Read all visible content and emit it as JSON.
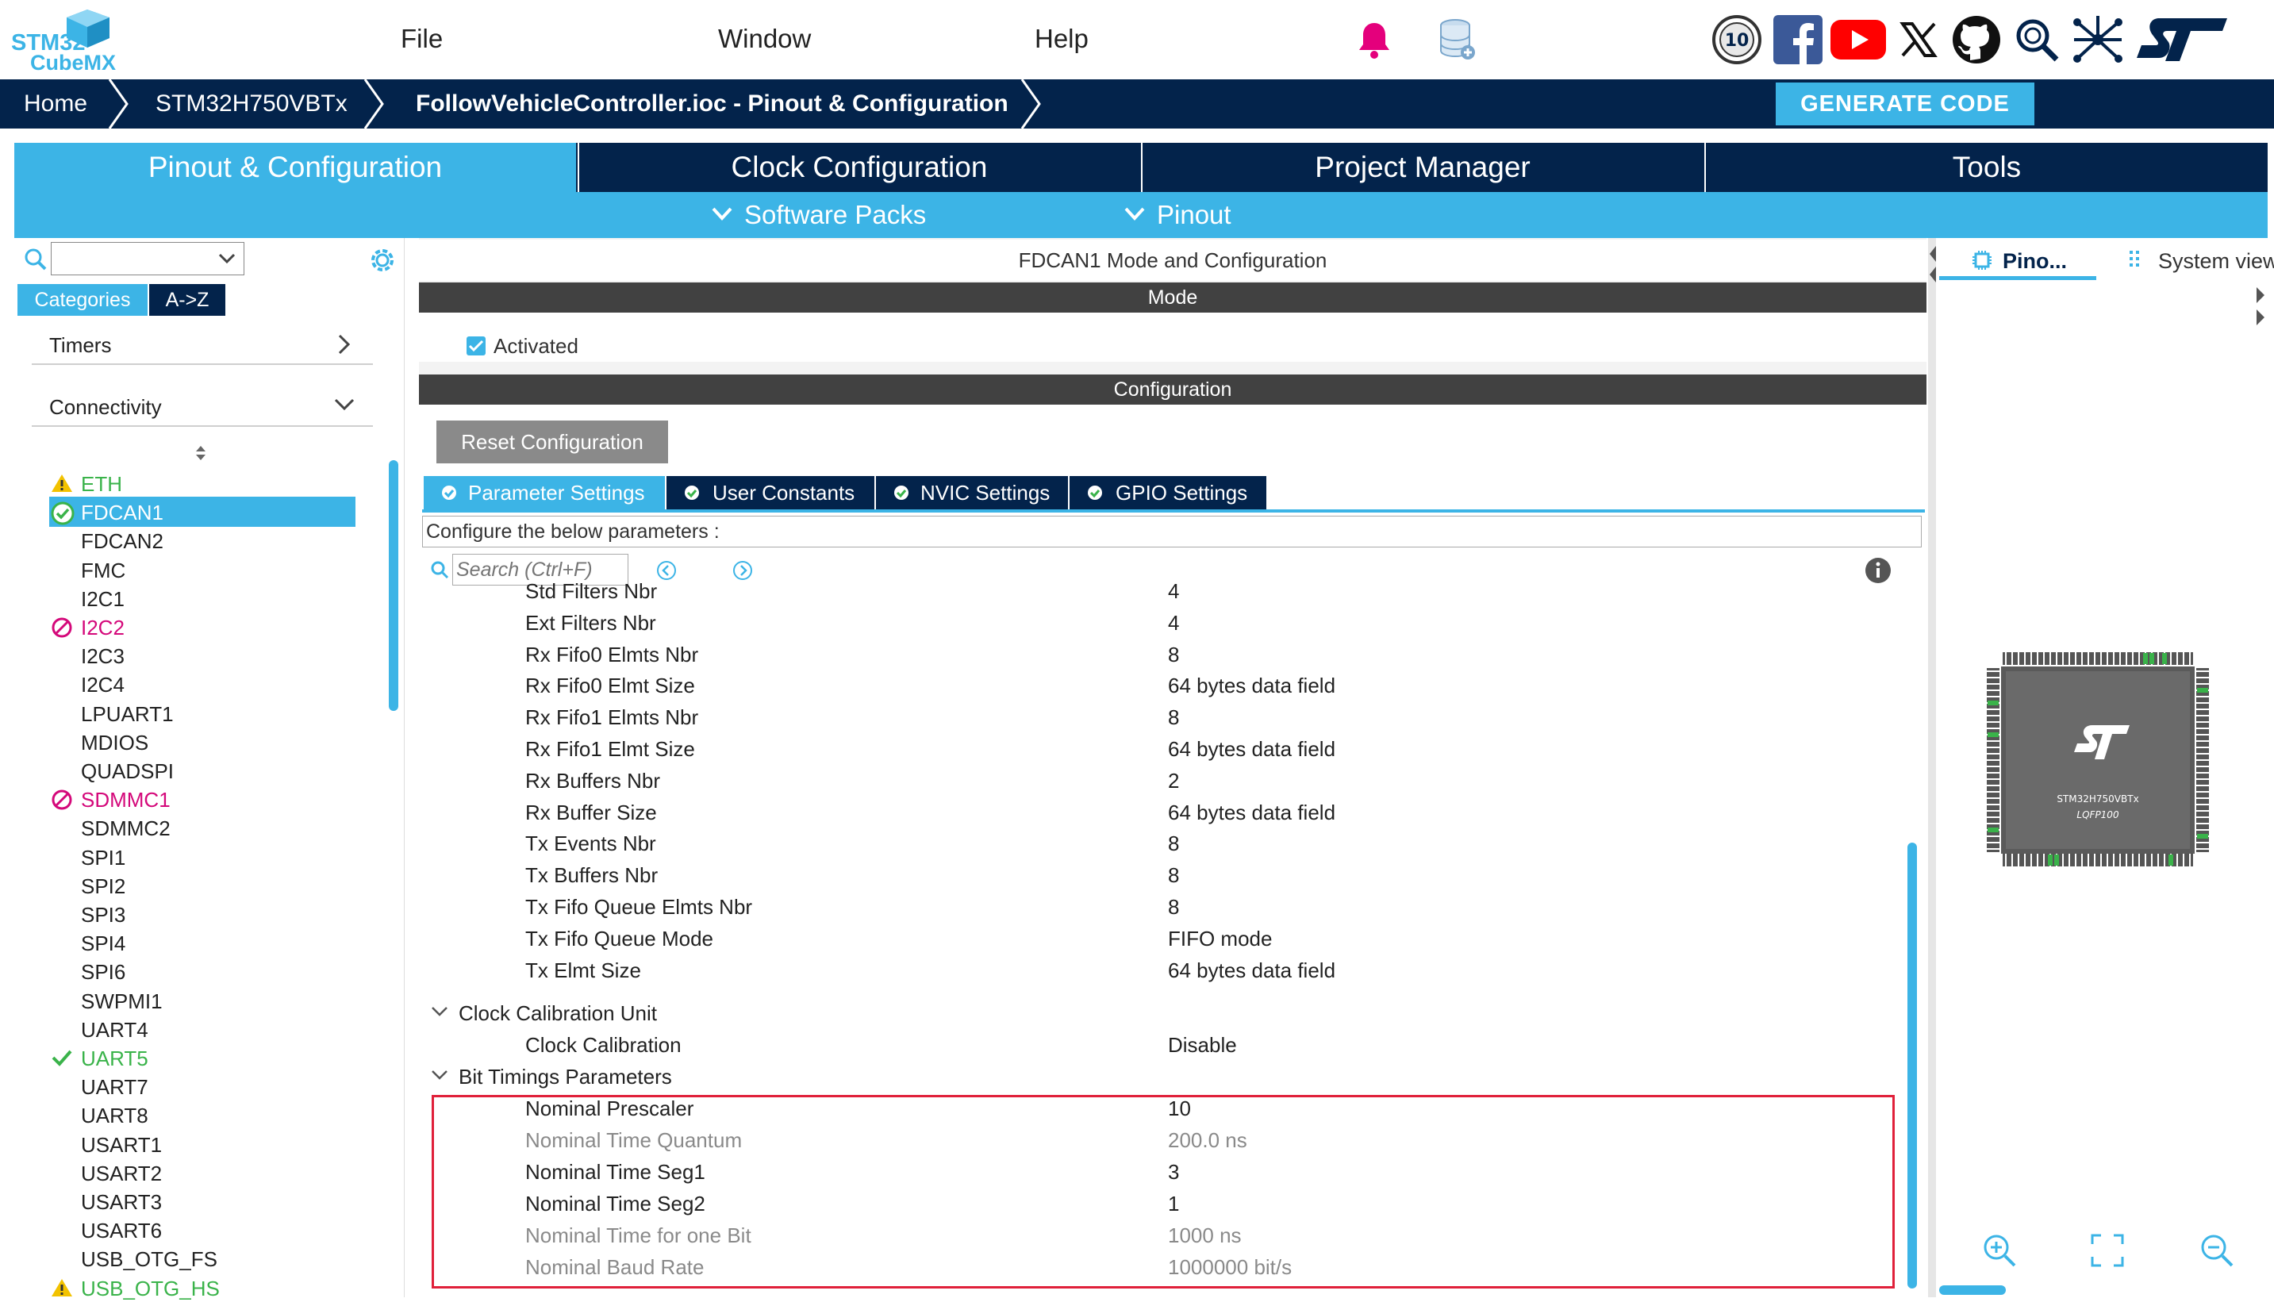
{
  "app": {
    "logo_line1": "STM32",
    "logo_line2": "CubeMX",
    "menu": [
      "File",
      "Window",
      "Help"
    ]
  },
  "breadcrumb": {
    "home": "Home",
    "device": "STM32H750VBTx",
    "project": "FollowVehicleController.ioc - Pinout & Configuration"
  },
  "generate_label": "GENERATE CODE",
  "main_tabs": [
    "Pinout & Configuration",
    "Clock Configuration",
    "Project Manager",
    "Tools"
  ],
  "sub_menus": [
    "Software Packs",
    "Pinout"
  ],
  "left": {
    "view_tabs": [
      "Categories",
      "A->Z"
    ],
    "categories": [
      "Timers",
      "Connectivity"
    ],
    "items": [
      {
        "label": "ETH",
        "state": "warning"
      },
      {
        "label": "FDCAN1",
        "state": "selected"
      },
      {
        "label": "FDCAN2",
        "state": ""
      },
      {
        "label": "FMC",
        "state": ""
      },
      {
        "label": "I2C1",
        "state": ""
      },
      {
        "label": "I2C2",
        "state": "disabled"
      },
      {
        "label": "I2C3",
        "state": ""
      },
      {
        "label": "I2C4",
        "state": ""
      },
      {
        "label": "LPUART1",
        "state": ""
      },
      {
        "label": "MDIOS",
        "state": ""
      },
      {
        "label": "QUADSPI",
        "state": ""
      },
      {
        "label": "SDMMC1",
        "state": "disabled"
      },
      {
        "label": "SDMMC2",
        "state": ""
      },
      {
        "label": "SPI1",
        "state": ""
      },
      {
        "label": "SPI2",
        "state": ""
      },
      {
        "label": "SPI3",
        "state": ""
      },
      {
        "label": "SPI4",
        "state": ""
      },
      {
        "label": "SPI6",
        "state": ""
      },
      {
        "label": "SWPMI1",
        "state": ""
      },
      {
        "label": "UART4",
        "state": ""
      },
      {
        "label": "UART5",
        "state": "ok"
      },
      {
        "label": "UART7",
        "state": ""
      },
      {
        "label": "UART8",
        "state": ""
      },
      {
        "label": "USART1",
        "state": ""
      },
      {
        "label": "USART2",
        "state": ""
      },
      {
        "label": "USART3",
        "state": ""
      },
      {
        "label": "USART6",
        "state": ""
      },
      {
        "label": "USB_OTG_FS",
        "state": ""
      },
      {
        "label": "USB_OTG_HS",
        "state": "warning"
      }
    ]
  },
  "center": {
    "title": "FDCAN1 Mode and Configuration",
    "mode_header": "Mode",
    "activated_label": "Activated",
    "config_header": "Configuration",
    "reset_label": "Reset Configuration",
    "param_tabs": [
      "Parameter Settings",
      "User Constants",
      "NVIC Settings",
      "GPIO Settings"
    ],
    "configure_text": "Configure the below parameters :",
    "search_placeholder": "Search (Ctrl+F)",
    "params": [
      {
        "name": "Std Filters Nbr",
        "value": "4"
      },
      {
        "name": "Ext Filters Nbr",
        "value": "4"
      },
      {
        "name": "Rx Fifo0 Elmts Nbr",
        "value": "8"
      },
      {
        "name": "Rx Fifo0 Elmt Size",
        "value": "64 bytes data field"
      },
      {
        "name": "Rx Fifo1 Elmts Nbr",
        "value": "8"
      },
      {
        "name": "Rx Fifo1 Elmt Size",
        "value": "64 bytes data field"
      },
      {
        "name": "Rx Buffers Nbr",
        "value": "2"
      },
      {
        "name": "Rx Buffer Size",
        "value": "64 bytes data field"
      },
      {
        "name": "Tx Events Nbr",
        "value": "8"
      },
      {
        "name": "Tx Buffers Nbr",
        "value": "8"
      },
      {
        "name": "Tx Fifo Queue Elmts Nbr",
        "value": "8"
      },
      {
        "name": "Tx Fifo Queue Mode",
        "value": "FIFO mode"
      },
      {
        "name": "Tx Elmt Size",
        "value": "64 bytes data field"
      }
    ],
    "group_clock": "Clock Calibration Unit",
    "clock_param": {
      "name": "Clock Calibration",
      "value": "Disable"
    },
    "group_bit": "Bit Timings Parameters",
    "bit_params": [
      {
        "name": "Nominal Prescaler",
        "value": "10",
        "dim": false
      },
      {
        "name": "Nominal Time Quantum",
        "value": "200.0 ns",
        "dim": true
      },
      {
        "name": "Nominal Time Seg1",
        "value": "3",
        "dim": false
      },
      {
        "name": "Nominal Time Seg2",
        "value": "1",
        "dim": false
      },
      {
        "name": "Nominal Time for one Bit",
        "value": "1000 ns",
        "dim": true
      },
      {
        "name": "Nominal Baud Rate",
        "value": "1000000 bit/s",
        "dim": true
      }
    ]
  },
  "right": {
    "tab_pinout": "Pino...",
    "tab_system": "System view",
    "chip_name": "STM32H750VBTx",
    "chip_package": "LQFP100"
  },
  "colors": {
    "navy": "#03234b",
    "accent": "#3cb4e6",
    "selected": "#3cb4e6",
    "ok": "#3ab34a",
    "warning": "#f2c200",
    "disabled": "#d4087a",
    "highlight": "#e0203a"
  }
}
